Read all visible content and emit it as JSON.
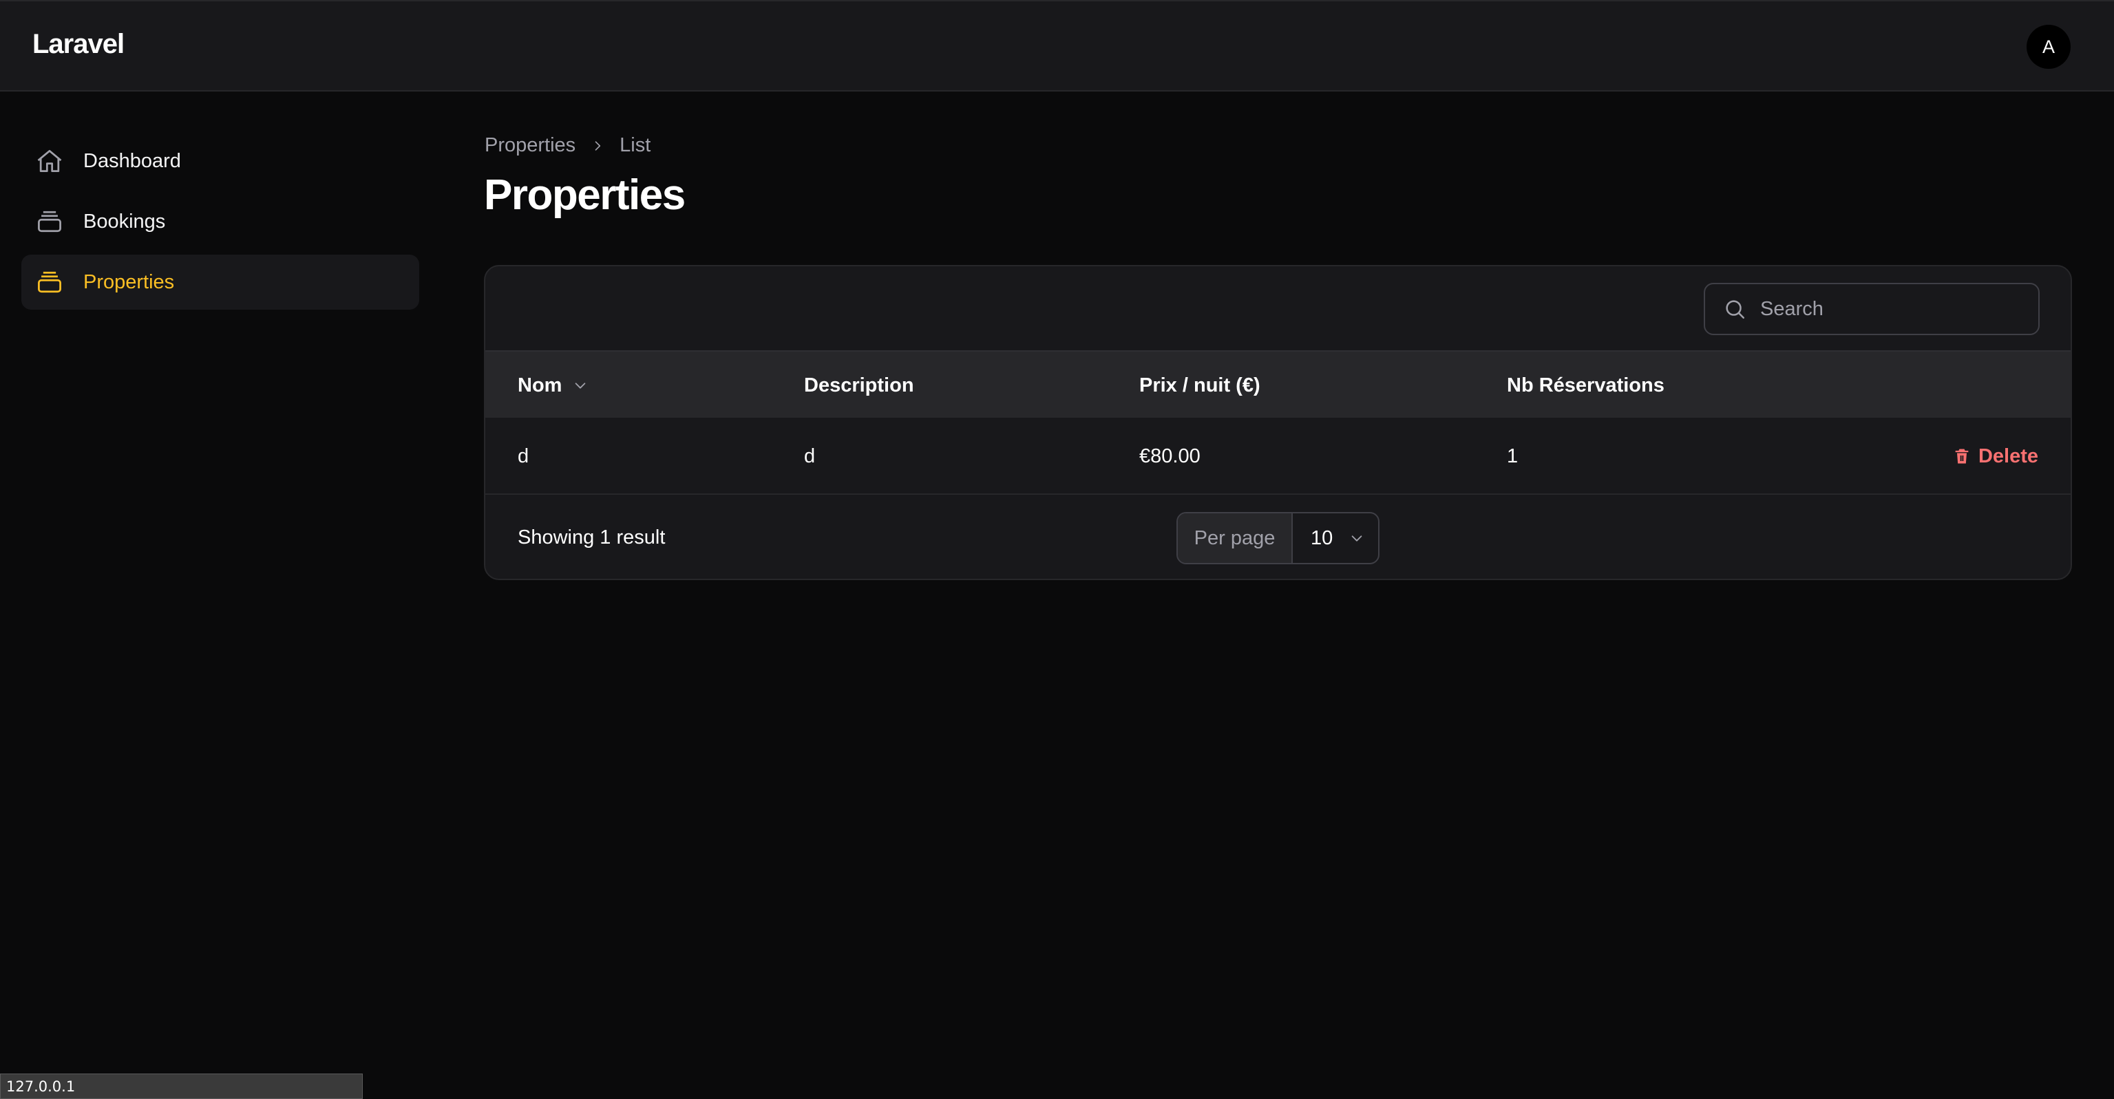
{
  "app": {
    "brand": "Laravel",
    "user_initial": "A"
  },
  "sidebar": {
    "items": [
      {
        "label": "Dashboard",
        "icon": "home-icon",
        "active": false
      },
      {
        "label": "Bookings",
        "icon": "stack-icon",
        "active": false
      },
      {
        "label": "Properties",
        "icon": "stack-icon",
        "active": true
      }
    ]
  },
  "breadcrumb": {
    "parent": "Properties",
    "current": "List"
  },
  "page": {
    "title": "Properties"
  },
  "search": {
    "placeholder": "Search"
  },
  "table": {
    "columns": [
      "Nom",
      "Description",
      "Prix / nuit (€)",
      "Nb Réservations"
    ],
    "sortable_column": "Nom",
    "rows": [
      {
        "nom": "d",
        "description": "d",
        "prix": "€80.00",
        "reservations": "1",
        "action": "Delete"
      }
    ]
  },
  "footer": {
    "summary": "Showing 1 result",
    "per_page_label": "Per page",
    "per_page_value": "10"
  },
  "statusbar": {
    "url": "127.0.0.1"
  },
  "colors": {
    "accent": "#fbbf24",
    "danger": "#f87171",
    "background": "#0a0a0b",
    "surface": "#18181b"
  }
}
